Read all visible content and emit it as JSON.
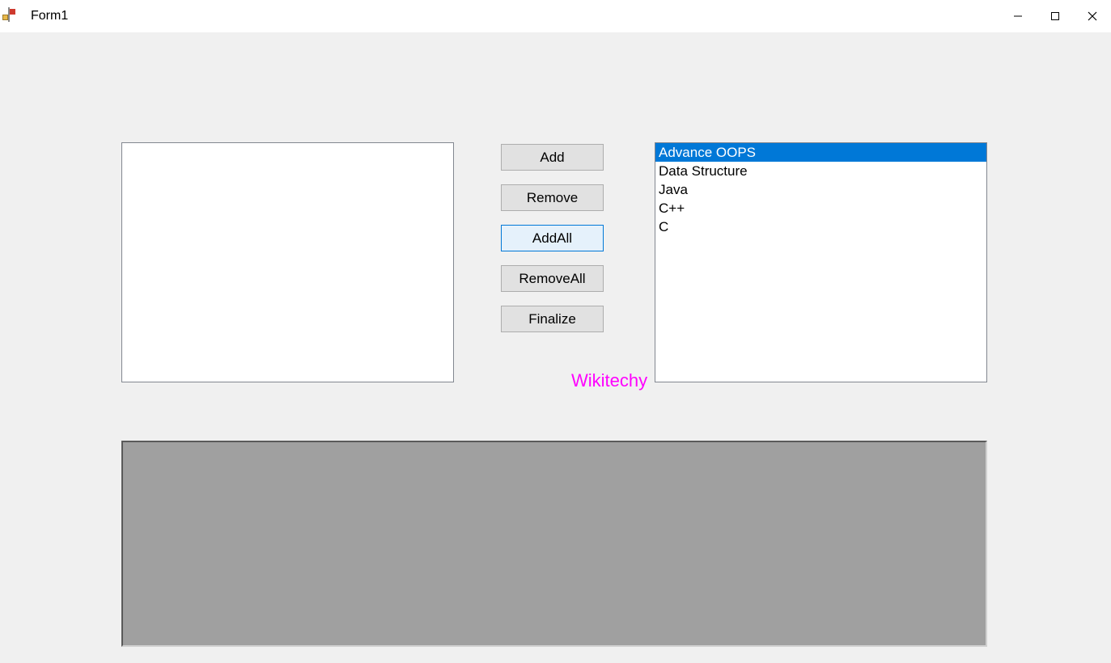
{
  "window": {
    "title": "Form1"
  },
  "buttons": {
    "add": "Add",
    "remove": "Remove",
    "addall": "AddAll",
    "removeall": "RemoveAll",
    "finalize": "Finalize"
  },
  "listbox_left": {
    "items": []
  },
  "listbox_right": {
    "items": [
      {
        "label": "Advance OOPS",
        "selected": true
      },
      {
        "label": "Data Structure",
        "selected": false
      },
      {
        "label": "Java",
        "selected": false
      },
      {
        "label": "C++",
        "selected": false
      },
      {
        "label": "C",
        "selected": false
      }
    ]
  },
  "watermark": "Wikitechy"
}
